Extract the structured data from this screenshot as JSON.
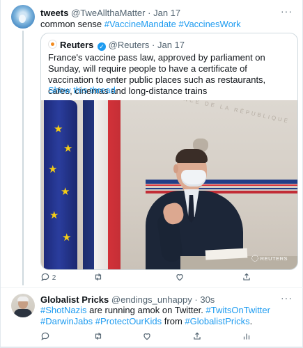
{
  "tweet1": {
    "display_name": "tweets",
    "handle": "@TweAllthaMatter",
    "separator": "·",
    "time": "Jan 17",
    "text_prefix": "common sense",
    "hashtags": [
      "#VaccineMandate",
      "#VaccinesWork"
    ],
    "quote": {
      "name": "Reuters",
      "verified_glyph": "✓",
      "handle": "@Reuters",
      "separator": "·",
      "time": "Jan 17",
      "text": "France's vaccine pass law, approved by parliament on Sunday, will require people to have a certificate of vaccination to enter public places such as restaurants, cafes, cinemas and long-distance trains",
      "show_thread": "Show this thread",
      "image_watermark": "REUTERS"
    },
    "actions": {
      "reply_count": "2",
      "retweet_count": "",
      "like_count": ""
    }
  },
  "tweet2": {
    "display_name": "Globalist Pricks",
    "handle": "@endings_unhappy",
    "separator": "·",
    "time": "30s",
    "segments": {
      "h1": "#ShotNazis",
      "t1": " are running amok on Twitter. ",
      "h2": "#TwitsOnTwitter",
      "t2": " ",
      "h3": "#DarwinJabs",
      "t3": " ",
      "h4": "#ProtectOurKids",
      "t4": " from ",
      "h5": "#GlobalistPricks",
      "t5": "."
    }
  },
  "more_glyph": "···",
  "colors": {
    "link": "#1d9bf0",
    "muted": "#536471",
    "text": "#0f1419"
  },
  "icons": [
    "reply-icon",
    "retweet-icon",
    "like-icon",
    "share-icon",
    "analytics-icon",
    "verified-badge-icon"
  ]
}
